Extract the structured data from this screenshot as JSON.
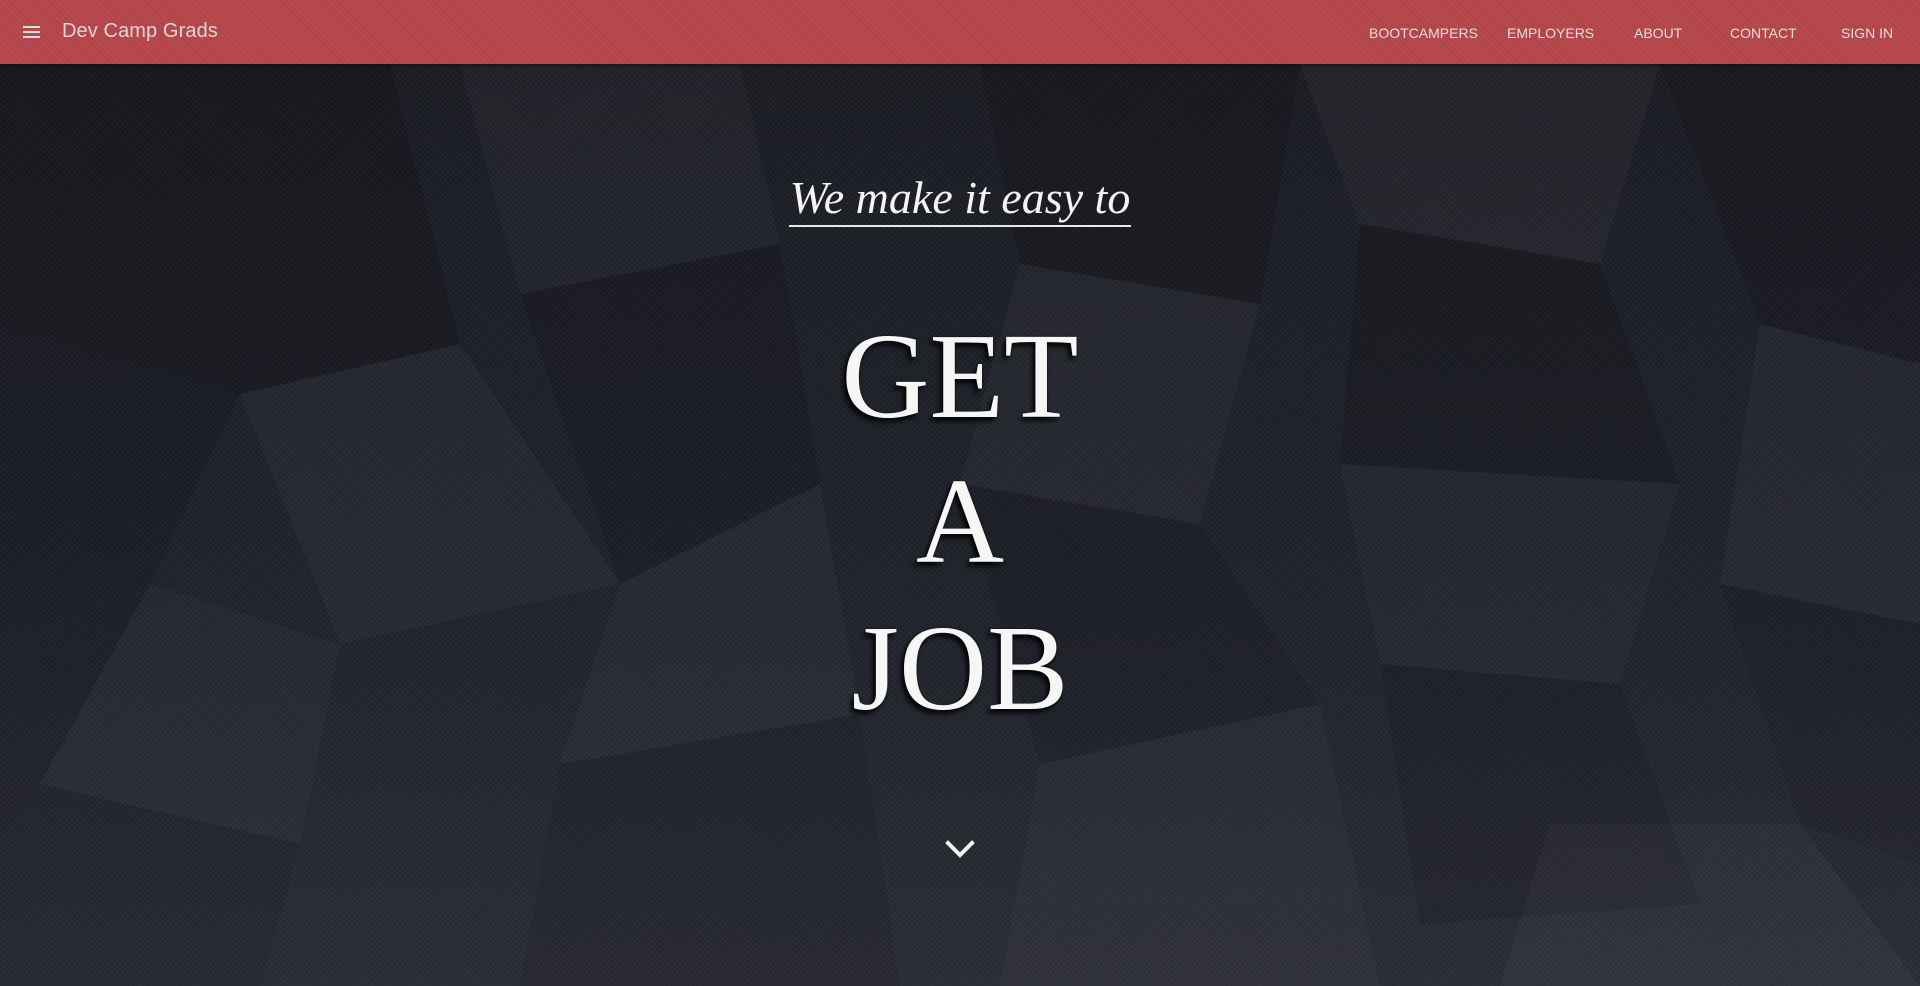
{
  "navbar": {
    "menu_icon": "hamburger-menu-icon",
    "brand": "Dev Camp Grads",
    "links": [
      {
        "label": "BOOTCAMPERS"
      },
      {
        "label": "EMPLOYERS"
      },
      {
        "label": "ABOUT"
      },
      {
        "label": "CONTACT"
      },
      {
        "label": "SIGN IN"
      }
    ],
    "color": "#b5464a"
  },
  "hero": {
    "tagline": "We make it easy to",
    "headline_lines": [
      "GET",
      "A",
      "JOB"
    ],
    "scroll_icon": "chevron-down-icon",
    "background_color": "#1d1f26"
  }
}
